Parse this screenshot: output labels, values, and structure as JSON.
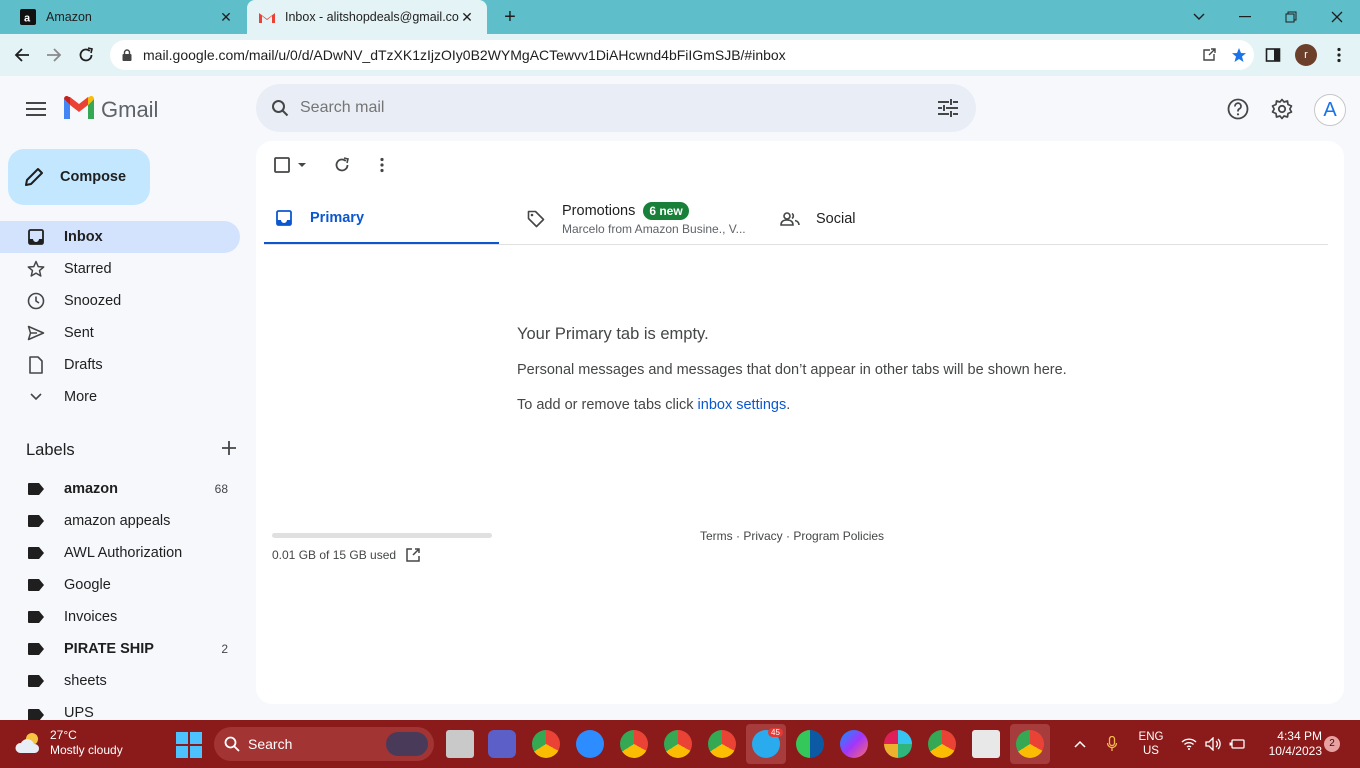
{
  "browser": {
    "tabs": [
      {
        "title": "Amazon",
        "favicon": "amazon-icon"
      },
      {
        "title": "Inbox - alitshopdeals@gmail.com",
        "favicon": "gmail-icon"
      }
    ],
    "url": "mail.google.com/mail/u/0/d/ADwNV_dTzXK1zIjzOIy0B2WYMgACTewvv1DiAHcwnd4bFiIGmSJB/#inbox",
    "profile_initial": "r"
  },
  "gmail": {
    "brand": "Gmail",
    "search_placeholder": "Search mail",
    "avatar_initial": "A",
    "compose_label": "Compose",
    "nav": [
      {
        "label": "Inbox",
        "icon": "inbox-icon"
      },
      {
        "label": "Starred",
        "icon": "star-icon"
      },
      {
        "label": "Snoozed",
        "icon": "clock-icon"
      },
      {
        "label": "Sent",
        "icon": "send-icon"
      },
      {
        "label": "Drafts",
        "icon": "draft-icon"
      },
      {
        "label": "More",
        "icon": "chevron-down-icon"
      }
    ],
    "labels_title": "Labels",
    "labels": [
      {
        "name": "amazon",
        "count": "68",
        "bold": true
      },
      {
        "name": "amazon appeals",
        "count": "",
        "bold": false
      },
      {
        "name": "AWL Authorization",
        "count": "",
        "bold": false
      },
      {
        "name": "Google",
        "count": "",
        "bold": false
      },
      {
        "name": "Invoices",
        "count": "",
        "bold": false
      },
      {
        "name": "PIRATE SHIP",
        "count": "2",
        "bold": true
      },
      {
        "name": "sheets",
        "count": "",
        "bold": false
      },
      {
        "name": "UPS",
        "count": "",
        "bold": false
      }
    ],
    "category_tabs": {
      "primary": "Primary",
      "promotions": "Promotions",
      "promotions_badge": "6 new",
      "promotions_sub": "Marcelo from Amazon Busine., V...",
      "social": "Social"
    },
    "empty": {
      "title": "Your Primary tab is empty.",
      "line1": "Personal messages and messages that don’t appear in other tabs will be shown here.",
      "line2_prefix": "To add or remove tabs click ",
      "line2_link": "inbox settings",
      "line2_suffix": "."
    },
    "storage": {
      "text": "0.01 GB of 15 GB used",
      "fraction": 0.001
    },
    "footer": {
      "terms": "Terms",
      "privacy": "Privacy",
      "policies": "Program Policies",
      "sep": " · "
    }
  },
  "taskbar": {
    "weather_temp": "27°C",
    "weather_desc": "Mostly cloudy",
    "search_label": "Search",
    "telegram_badge": "45",
    "lang_top": "ENG",
    "lang_bottom": "US",
    "time": "4:34 PM",
    "date": "10/4/2023",
    "notifications": "2"
  },
  "colors": {
    "tabbar": "#5ebfcb",
    "selected_nav": "#d3e3fd",
    "compose": "#c2e7ff",
    "accent": "#0b57d0",
    "badge_green": "#188038",
    "taskbar": "#8b1a1a"
  }
}
